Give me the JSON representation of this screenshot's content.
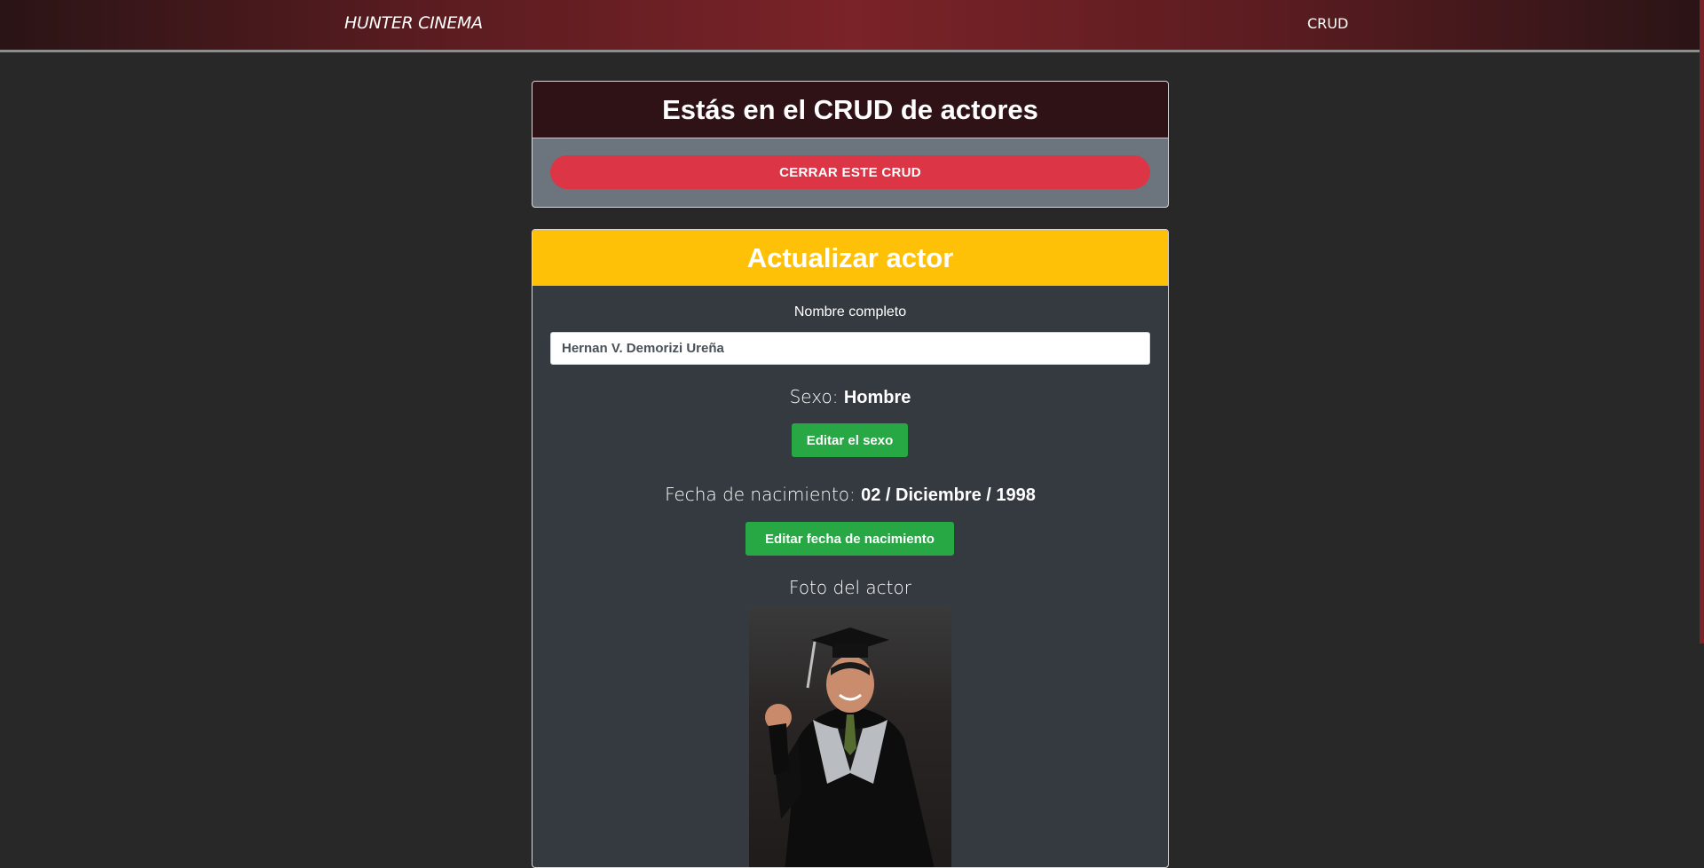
{
  "navbar": {
    "brand": "HUNTER CINEMA",
    "links": [
      "CRUD"
    ]
  },
  "crud_card": {
    "title": "Estás en el CRUD de actores",
    "close_button": "CERRAR ESTE CRUD"
  },
  "update_card": {
    "title": "Actualizar actor",
    "name_label": "Nombre completo",
    "name_value": "Hernan V. Demorizi Ureña",
    "sex_label": "Sexo:",
    "sex_value": "Hombre",
    "edit_sex_button": "Editar el sexo",
    "birth_label": "Fecha de nacimiento:",
    "birth_value": "02 / Diciembre / 1998",
    "edit_birth_button": "Editar fecha de nacimiento",
    "photo_label": "Foto del actor"
  },
  "colors": {
    "danger": "#dc3545",
    "warning": "#ffc107",
    "success": "#28a745",
    "card_dark": "#343a40",
    "card_secondary": "#6c757d"
  }
}
